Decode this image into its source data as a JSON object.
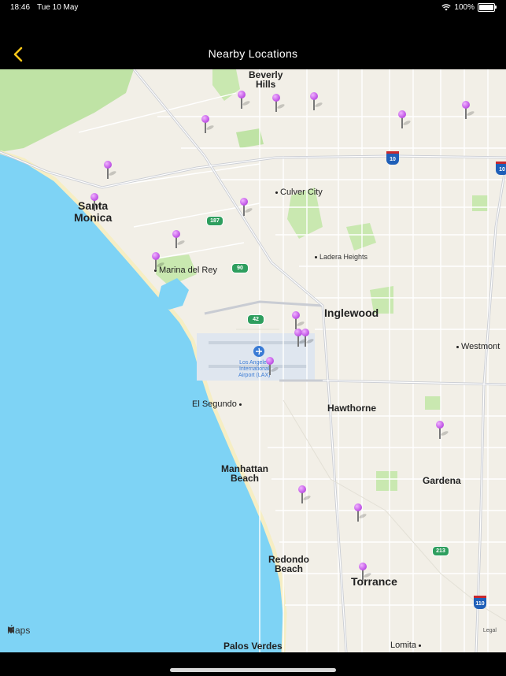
{
  "status_bar": {
    "time": "18:46",
    "date": "Tue 10 May",
    "battery": "100%"
  },
  "nav": {
    "title": "Nearby Locations"
  },
  "map": {
    "attribution": "Maps",
    "legal": "Legal",
    "places": {
      "beverly_hills": "Beverly\nHills",
      "santa_monica": "Santa\nMonica",
      "culver_city": "Culver City",
      "ladera_heights": "Ladera Heights",
      "marina_del_rey": "Marina del Rey",
      "inglewood": "Inglewood",
      "westmont": "Westmont",
      "lax": "Los Angeles\nInternational\nAirport (LAX)",
      "el_segundo": "El Segundo",
      "hawthorne": "Hawthorne",
      "manhattan_beach": "Manhattan\nBeach",
      "gardena": "Gardena",
      "redondo_beach": "Redondo\nBeach",
      "torrance": "Torrance",
      "palos_verdes": "Palos Verdes",
      "lomita": "Lomita"
    },
    "shields": {
      "i10": "10",
      "i10_east": "10",
      "ca187": "187",
      "ca90": "90",
      "ca42": "42",
      "ca213": "213",
      "i110": "110"
    },
    "pin_count": 19,
    "colors": {
      "water": "#7ed3f5",
      "land": "#f2efe7",
      "park": "#bfe3a5",
      "pin": "#c45be8",
      "accent": "#f5c518"
    }
  }
}
